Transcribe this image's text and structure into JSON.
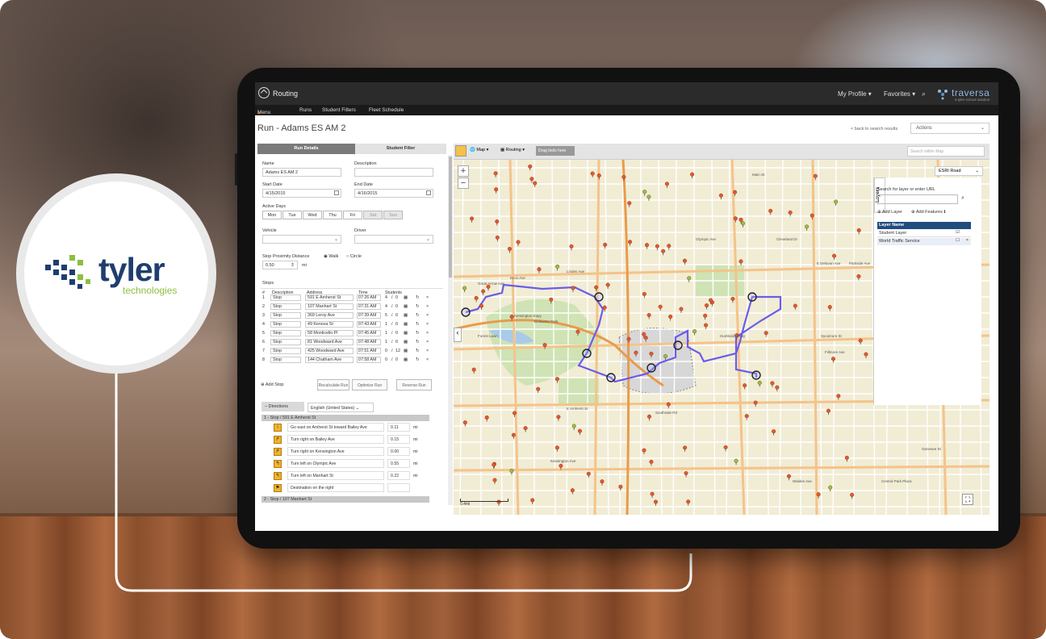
{
  "brand_logo": {
    "word": "tyler",
    "sub": "technologies"
  },
  "app": {
    "title": "Routing",
    "my_profile": "My Profile",
    "favorites": "Favorites",
    "brand_name": "traversa",
    "brand_tagline": "a tyler school solution",
    "menu_items": [
      "Menu",
      "Runs",
      "Student Filters",
      "Fleet Schedule"
    ]
  },
  "page": {
    "title": "Run - Adams ES AM 2",
    "back_link": "< back to search results",
    "actions_label": "Actions"
  },
  "panel": {
    "tabs": [
      "Run Details",
      "Student Filter"
    ],
    "name_label": "Name",
    "name_value": "Adams ES AM 2",
    "description_label": "Description",
    "start_label": "Start Date",
    "start_value": "4/15/2015",
    "end_label": "End Date",
    "end_value": "4/16/2015",
    "active_days_label": "Active Days",
    "days": [
      "Mon",
      "Tue",
      "Wed",
      "Thu",
      "Fri",
      "Sat",
      "Sun"
    ],
    "vehicle_label": "Vehicle",
    "driver_label": "Driver",
    "proximity_label": "Stop Proximity Distance",
    "proximity_value": "0.50",
    "proximity_unit": "mi",
    "walk_label": "Walk",
    "circle_label": "Circle",
    "stops_label": "Stops",
    "columns": [
      "#",
      "Description",
      "Address",
      "Time",
      "Students"
    ],
    "stops": [
      {
        "n": "1",
        "desc": "Stop",
        "addr": "591 E Amherst St",
        "time": "07:26 AM",
        "students": "4",
        "total": "0"
      },
      {
        "n": "2",
        "desc": "Stop",
        "addr": "107 Manhart St",
        "time": "07:31 AM",
        "students": "4",
        "total": "0"
      },
      {
        "n": "3",
        "desc": "Stop",
        "addr": "369 Leroy Ave",
        "time": "07:39 AM",
        "students": "5",
        "total": "0"
      },
      {
        "n": "4",
        "desc": "Stop",
        "addr": "49 Kenova St",
        "time": "07:43 AM",
        "students": "1",
        "total": "0"
      },
      {
        "n": "5",
        "desc": "Stop",
        "addr": "58 Monticello Pl",
        "time": "07:45 AM",
        "students": "1",
        "total": "0"
      },
      {
        "n": "6",
        "desc": "Stop",
        "addr": "81 Woodward Ave",
        "time": "07:48 AM",
        "students": "1",
        "total": "0"
      },
      {
        "n": "7",
        "desc": "Stop",
        "addr": "425 Woodward Ave",
        "time": "07:51 AM",
        "students": "0",
        "total": "12"
      },
      {
        "n": "8",
        "desc": "Stop",
        "addr": "144 Chatham Ave",
        "time": "07:58 AM",
        "students": "0",
        "total": "0"
      }
    ],
    "add_stop": "Add Stop",
    "recalculate": "Recalculate Run",
    "optimize": "Optimize Run",
    "reverse": "Reverse Run",
    "directions_label": "Directions",
    "language": "English (United States)",
    "dir_header_1": "1 - Stop / 591 E Amherst St",
    "dir_header_2": "2 - Stop / 107 Manhart St",
    "directions": [
      {
        "text": "Go east on Amherst St toward Bailey Ave",
        "dist": "0.11",
        "unit": "mi",
        "icon": "↑"
      },
      {
        "text": "Turn right on Bailey Ave",
        "dist": "0.15",
        "unit": "mi",
        "icon": "↱"
      },
      {
        "text": "Turn right on Kensington Ave",
        "dist": "0.00",
        "unit": "mi",
        "icon": "↱"
      },
      {
        "text": "Turn left on Olympic Ave",
        "dist": "0.55",
        "unit": "mi",
        "icon": "↰"
      },
      {
        "text": "Turn left on Manhart St",
        "dist": "0.22",
        "unit": "mi",
        "icon": "↰"
      },
      {
        "text": "Destination  on the right",
        "dist": "",
        "unit": "",
        "icon": "⚑"
      }
    ]
  },
  "map": {
    "map_btn": "Map",
    "routing_btn": "Routing",
    "drag_tools": "Drag tools here",
    "search_placeholder": "Search within Map",
    "basemap": "ESRI Road",
    "layers_tab": "Layers",
    "layer_search_label": "Search for layer or enter URL",
    "add_layer": "Add Layer",
    "add_features": "Add Features",
    "layer_name_header": "Layer Name",
    "layers": [
      "Student Layer",
      "World Traffic Service"
    ],
    "scale": "0.4mi",
    "street_labels": [
      {
        "t": "Great Arrow Ave"
      },
      {
        "t": "Knox Ave"
      },
      {
        "t": "Linden Ave"
      },
      {
        "t": "Kensington Expy"
      },
      {
        "t": "Delaware Park"
      },
      {
        "t": "Forest Lawn"
      },
      {
        "t": "Humboldt Pkwy"
      },
      {
        "t": "E Delavan Ave"
      },
      {
        "t": "Fillmore Ave"
      },
      {
        "t": "Bailey Ave"
      },
      {
        "t": "Genesee St"
      },
      {
        "t": "Walden Ave"
      },
      {
        "t": "Broadway"
      },
      {
        "t": "Sycamore St"
      },
      {
        "t": "E Amherst St"
      },
      {
        "t": "Kensington Ave"
      },
      {
        "t": "Cleveland Dr"
      },
      {
        "t": "Main St"
      },
      {
        "t": "Parkside Ave"
      },
      {
        "t": "Olympic Ave"
      },
      {
        "t": "Southside Rd"
      },
      {
        "t": "Central Park Plaza"
      }
    ]
  },
  "colors": {
    "route": "#6a5ce8",
    "accent": "#f47a20"
  }
}
